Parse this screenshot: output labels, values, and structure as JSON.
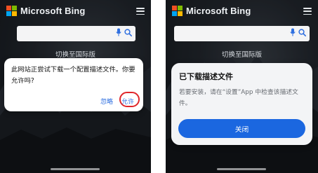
{
  "brand": {
    "name": "Microsoft Bing",
    "logo_colors": [
      "#f25022",
      "#7fba00",
      "#00a4ef",
      "#ffb900"
    ]
  },
  "search": {
    "icons": [
      "microphone-icon",
      "search-icon"
    ],
    "icon_color": "#2f6fe0"
  },
  "region_link": "切换至国际版",
  "left_dialog": {
    "message": "此网站正尝试下载一个配置描述文件。你要允许吗?",
    "ignore_label": "忽略",
    "allow_label": "允许",
    "highlight_color": "#e0262a"
  },
  "right_dialog": {
    "title": "已下载描述文件",
    "message": "若要安装，请在“设置”App 中检查该描述文件。",
    "close_label": "关闭",
    "button_color": "#1b67e0"
  }
}
